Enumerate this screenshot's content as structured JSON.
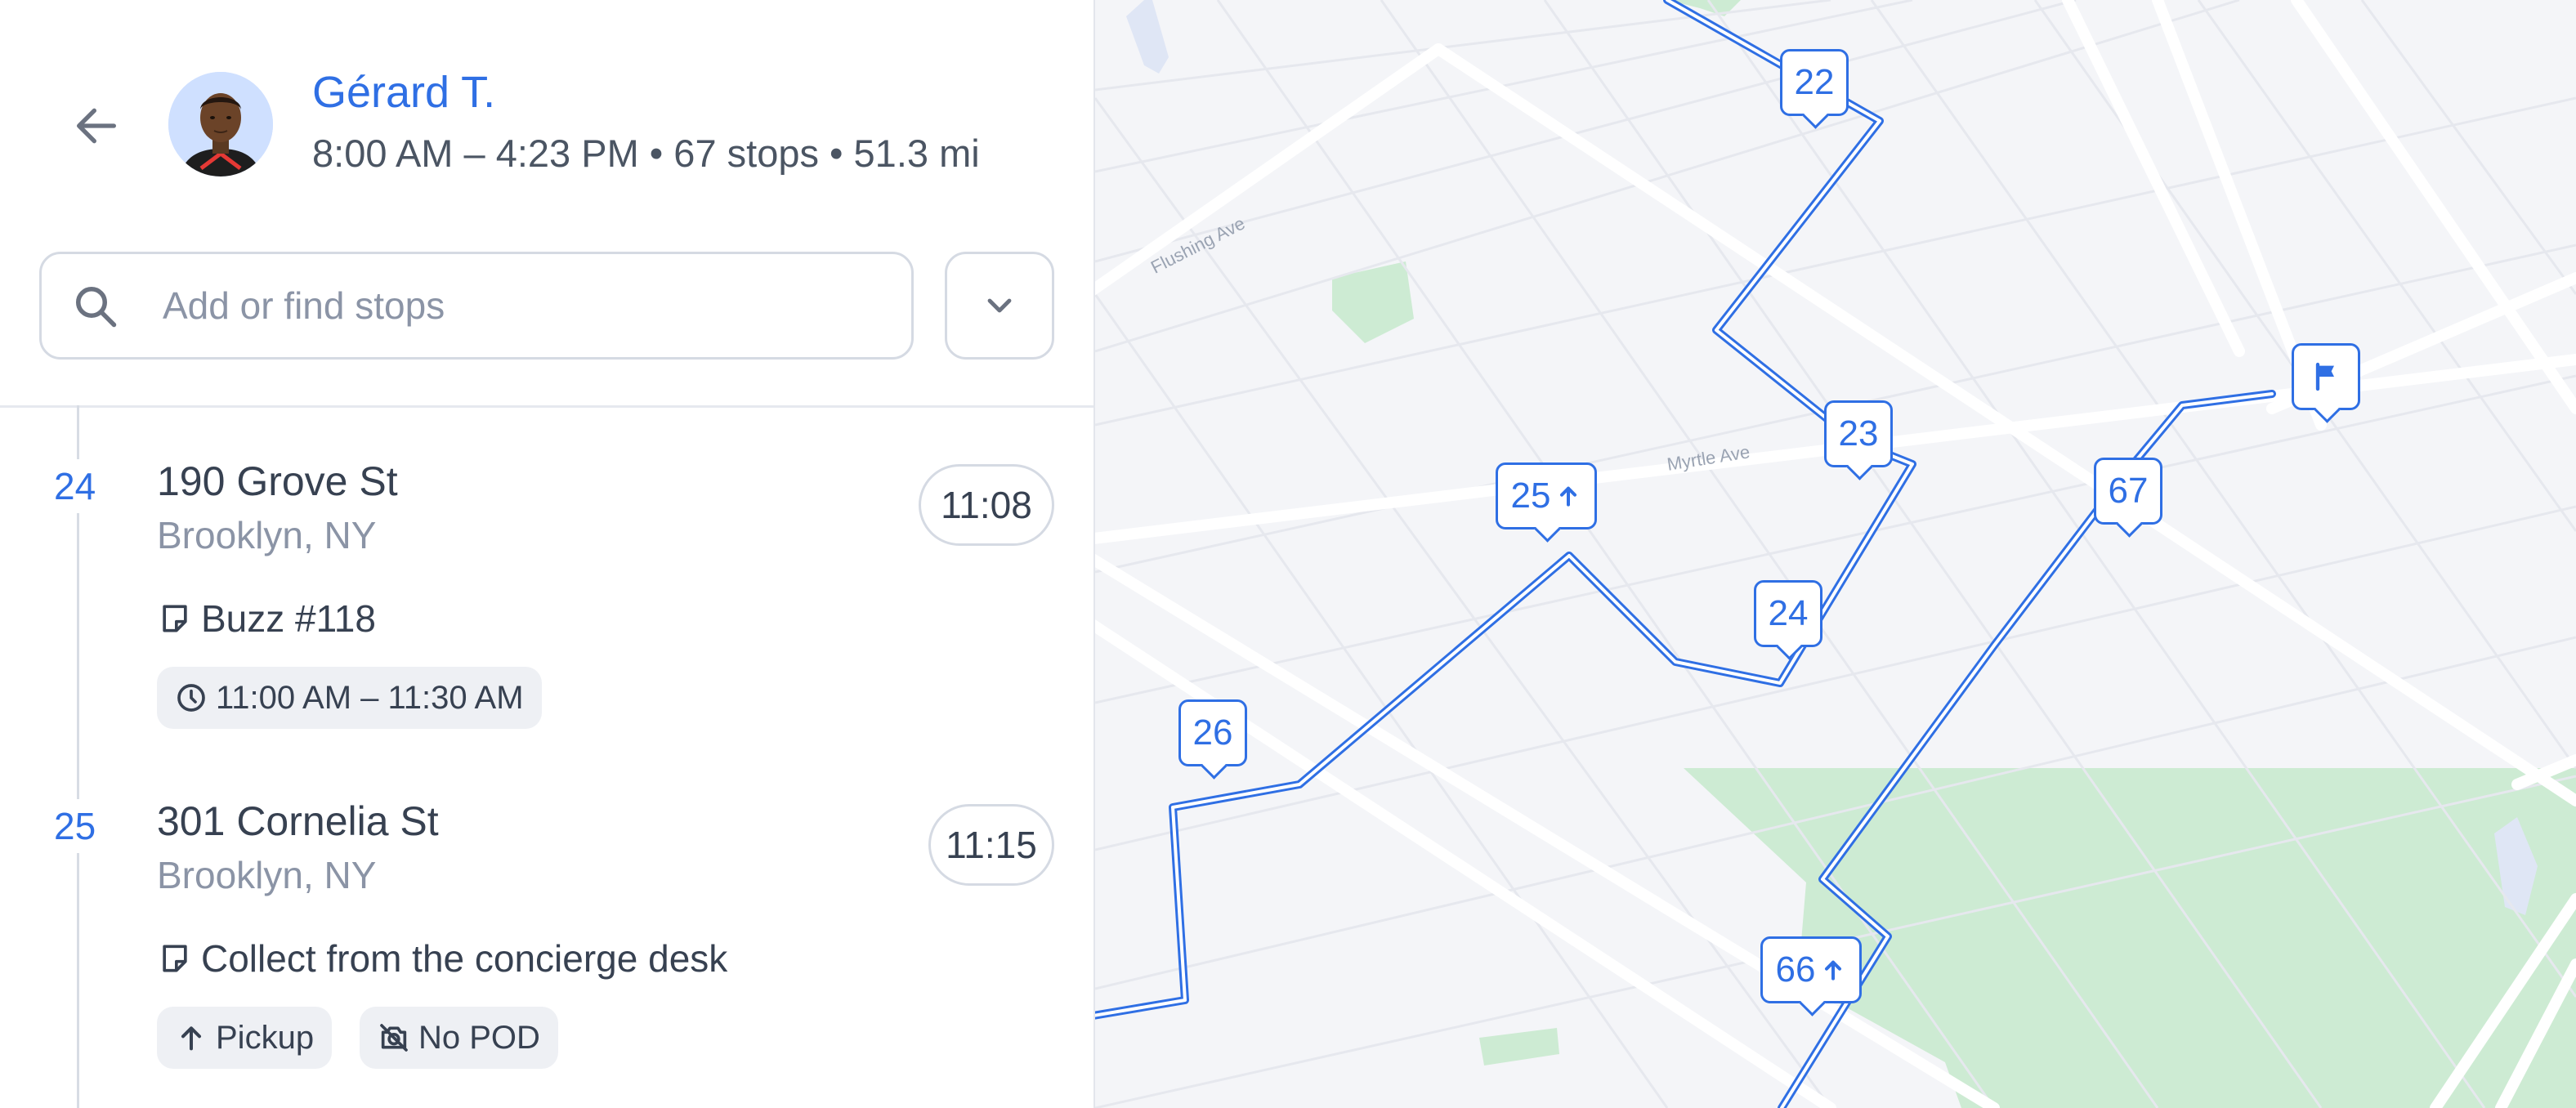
{
  "driver": {
    "name": "Gérard T.",
    "summary": "8:00 AM – 4:23 PM • 67 stops • 51.3 mi"
  },
  "search": {
    "placeholder": "Add or find stops"
  },
  "icons": {
    "back": "arrow-left-icon",
    "search": "search-icon",
    "dropdown": "chevron-down-icon",
    "note": "note-icon",
    "clock": "clock-icon",
    "pickup": "arrow-up-icon",
    "no_pod": "no-camera-icon",
    "finish": "flag-icon"
  },
  "colors": {
    "accent": "#2f6fe4",
    "route": "#2f6fe4",
    "park": "#cdebd3",
    "map_bg": "#f4f5f8"
  },
  "stops": [
    {
      "number": "24",
      "address": "190 Grove St",
      "city": "Brooklyn, NY",
      "eta": "11:08",
      "note": "Buzz #118",
      "chips": [
        {
          "icon": "clock-icon",
          "label": "11:00 AM – 11:30 AM"
        }
      ]
    },
    {
      "number": "25",
      "address": "301 Cornelia St",
      "city": "Brooklyn, NY",
      "eta": "11:15",
      "note": "Collect from the concierge desk",
      "chips": [
        {
          "icon": "arrow-up-icon",
          "label": "Pickup"
        },
        {
          "icon": "no-camera-icon",
          "label": "No POD"
        }
      ]
    }
  ],
  "map": {
    "streets": [
      "Flushing Ave",
      "Myrtle Ave"
    ],
    "markers": [
      {
        "label": "22",
        "icon": ""
      },
      {
        "label": "23",
        "icon": ""
      },
      {
        "label": "24",
        "icon": ""
      },
      {
        "label": "25",
        "icon": "arrow-up-icon"
      },
      {
        "label": "26",
        "icon": ""
      },
      {
        "label": "66",
        "icon": "arrow-up-icon"
      },
      {
        "label": "67",
        "icon": ""
      },
      {
        "label": "",
        "icon": "flag-icon"
      }
    ]
  }
}
